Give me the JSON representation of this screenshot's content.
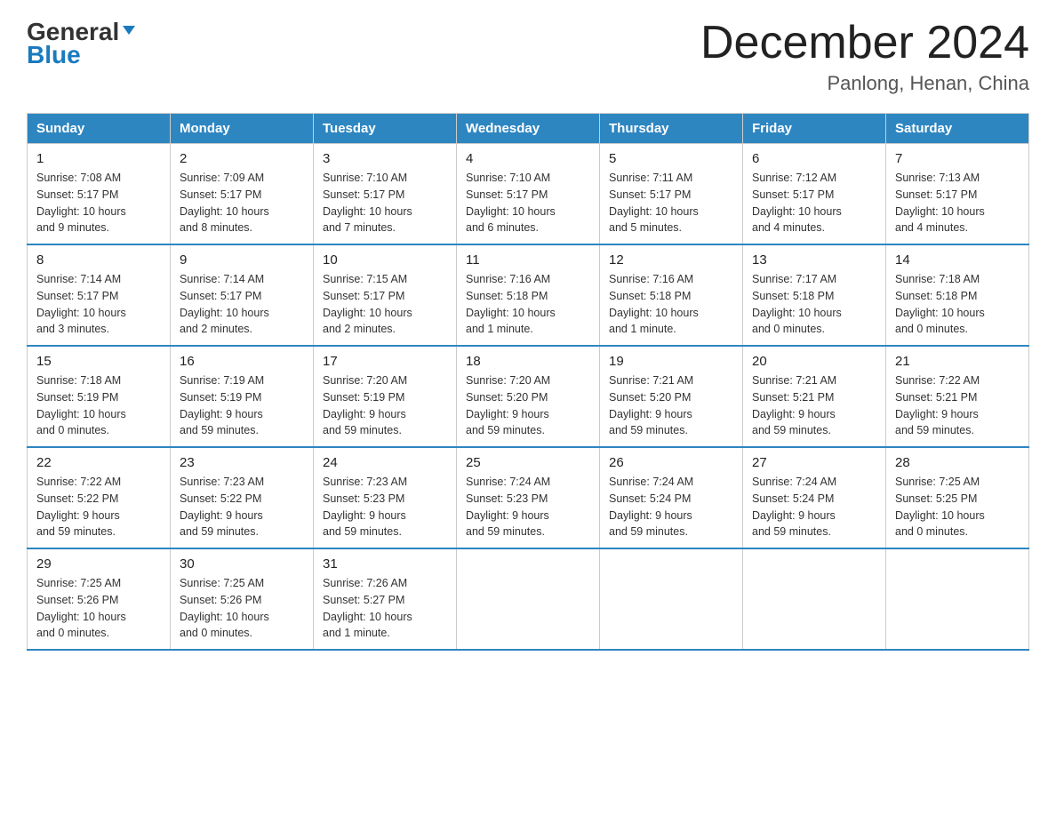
{
  "header": {
    "logo_general": "General",
    "logo_blue": "Blue",
    "title": "December 2024",
    "subtitle": "Panlong, Henan, China"
  },
  "days_of_week": [
    "Sunday",
    "Monday",
    "Tuesday",
    "Wednesday",
    "Thursday",
    "Friday",
    "Saturday"
  ],
  "weeks": [
    [
      {
        "day": "1",
        "sunrise": "7:08 AM",
        "sunset": "5:17 PM",
        "daylight": "10 hours and 9 minutes."
      },
      {
        "day": "2",
        "sunrise": "7:09 AM",
        "sunset": "5:17 PM",
        "daylight": "10 hours and 8 minutes."
      },
      {
        "day": "3",
        "sunrise": "7:10 AM",
        "sunset": "5:17 PM",
        "daylight": "10 hours and 7 minutes."
      },
      {
        "day": "4",
        "sunrise": "7:10 AM",
        "sunset": "5:17 PM",
        "daylight": "10 hours and 6 minutes."
      },
      {
        "day": "5",
        "sunrise": "7:11 AM",
        "sunset": "5:17 PM",
        "daylight": "10 hours and 5 minutes."
      },
      {
        "day": "6",
        "sunrise": "7:12 AM",
        "sunset": "5:17 PM",
        "daylight": "10 hours and 4 minutes."
      },
      {
        "day": "7",
        "sunrise": "7:13 AM",
        "sunset": "5:17 PM",
        "daylight": "10 hours and 4 minutes."
      }
    ],
    [
      {
        "day": "8",
        "sunrise": "7:14 AM",
        "sunset": "5:17 PM",
        "daylight": "10 hours and 3 minutes."
      },
      {
        "day": "9",
        "sunrise": "7:14 AM",
        "sunset": "5:17 PM",
        "daylight": "10 hours and 2 minutes."
      },
      {
        "day": "10",
        "sunrise": "7:15 AM",
        "sunset": "5:17 PM",
        "daylight": "10 hours and 2 minutes."
      },
      {
        "day": "11",
        "sunrise": "7:16 AM",
        "sunset": "5:18 PM",
        "daylight": "10 hours and 1 minute."
      },
      {
        "day": "12",
        "sunrise": "7:16 AM",
        "sunset": "5:18 PM",
        "daylight": "10 hours and 1 minute."
      },
      {
        "day": "13",
        "sunrise": "7:17 AM",
        "sunset": "5:18 PM",
        "daylight": "10 hours and 0 minutes."
      },
      {
        "day": "14",
        "sunrise": "7:18 AM",
        "sunset": "5:18 PM",
        "daylight": "10 hours and 0 minutes."
      }
    ],
    [
      {
        "day": "15",
        "sunrise": "7:18 AM",
        "sunset": "5:19 PM",
        "daylight": "10 hours and 0 minutes."
      },
      {
        "day": "16",
        "sunrise": "7:19 AM",
        "sunset": "5:19 PM",
        "daylight": "9 hours and 59 minutes."
      },
      {
        "day": "17",
        "sunrise": "7:20 AM",
        "sunset": "5:19 PM",
        "daylight": "9 hours and 59 minutes."
      },
      {
        "day": "18",
        "sunrise": "7:20 AM",
        "sunset": "5:20 PM",
        "daylight": "9 hours and 59 minutes."
      },
      {
        "day": "19",
        "sunrise": "7:21 AM",
        "sunset": "5:20 PM",
        "daylight": "9 hours and 59 minutes."
      },
      {
        "day": "20",
        "sunrise": "7:21 AM",
        "sunset": "5:21 PM",
        "daylight": "9 hours and 59 minutes."
      },
      {
        "day": "21",
        "sunrise": "7:22 AM",
        "sunset": "5:21 PM",
        "daylight": "9 hours and 59 minutes."
      }
    ],
    [
      {
        "day": "22",
        "sunrise": "7:22 AM",
        "sunset": "5:22 PM",
        "daylight": "9 hours and 59 minutes."
      },
      {
        "day": "23",
        "sunrise": "7:23 AM",
        "sunset": "5:22 PM",
        "daylight": "9 hours and 59 minutes."
      },
      {
        "day": "24",
        "sunrise": "7:23 AM",
        "sunset": "5:23 PM",
        "daylight": "9 hours and 59 minutes."
      },
      {
        "day": "25",
        "sunrise": "7:24 AM",
        "sunset": "5:23 PM",
        "daylight": "9 hours and 59 minutes."
      },
      {
        "day": "26",
        "sunrise": "7:24 AM",
        "sunset": "5:24 PM",
        "daylight": "9 hours and 59 minutes."
      },
      {
        "day": "27",
        "sunrise": "7:24 AM",
        "sunset": "5:24 PM",
        "daylight": "9 hours and 59 minutes."
      },
      {
        "day": "28",
        "sunrise": "7:25 AM",
        "sunset": "5:25 PM",
        "daylight": "10 hours and 0 minutes."
      }
    ],
    [
      {
        "day": "29",
        "sunrise": "7:25 AM",
        "sunset": "5:26 PM",
        "daylight": "10 hours and 0 minutes."
      },
      {
        "day": "30",
        "sunrise": "7:25 AM",
        "sunset": "5:26 PM",
        "daylight": "10 hours and 0 minutes."
      },
      {
        "day": "31",
        "sunrise": "7:26 AM",
        "sunset": "5:27 PM",
        "daylight": "10 hours and 1 minute."
      },
      null,
      null,
      null,
      null
    ]
  ],
  "labels": {
    "sunrise": "Sunrise:",
    "sunset": "Sunset:",
    "daylight": "Daylight:"
  }
}
